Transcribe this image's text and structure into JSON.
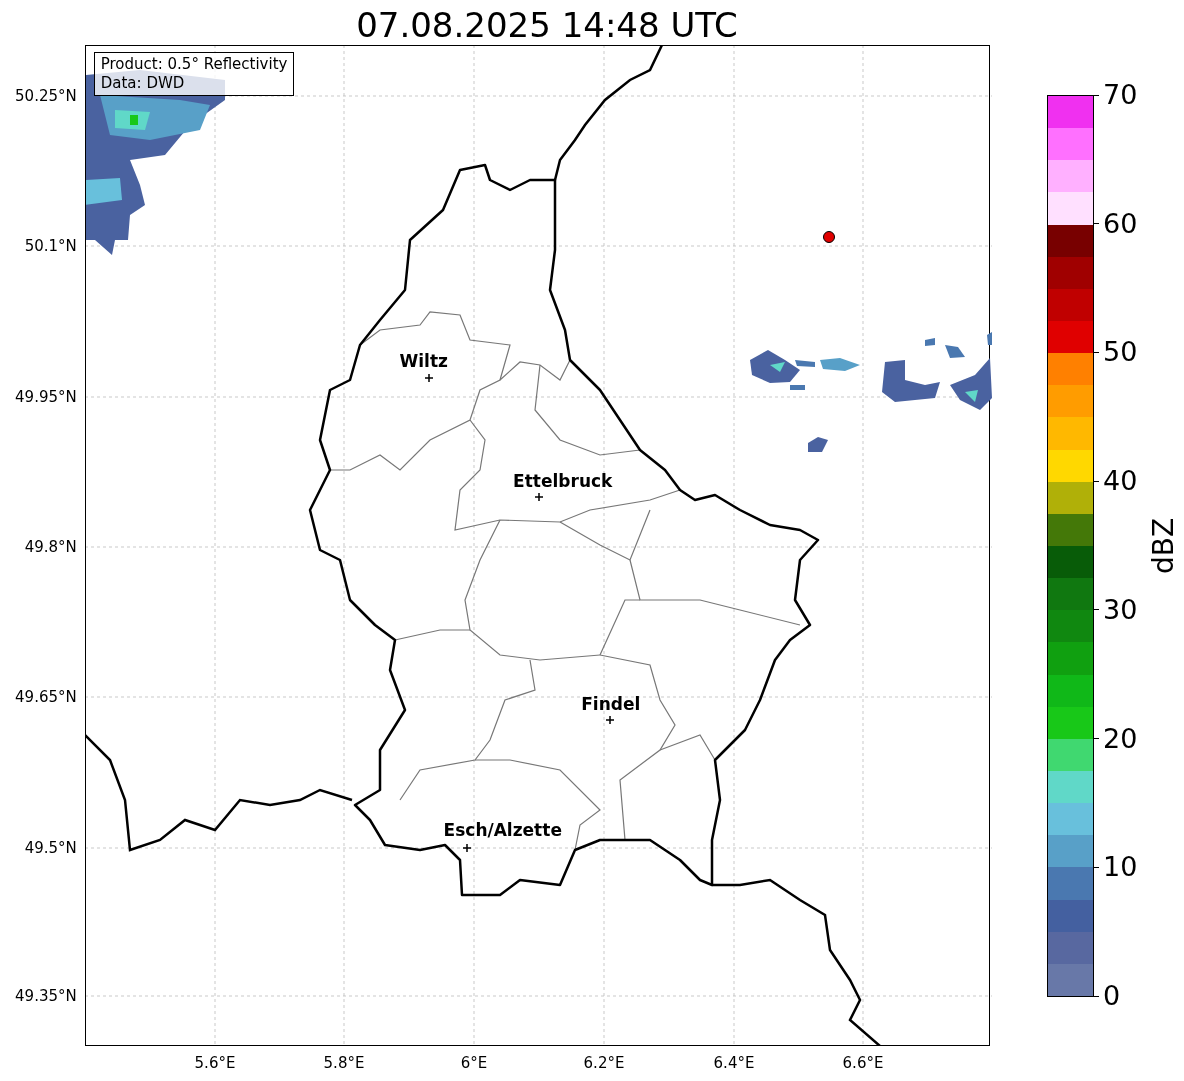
{
  "title": "07.08.2025 14:48 UTC",
  "info_box": {
    "lines": [
      "Product: 0.5° Reflectivity",
      "Data: DWD"
    ]
  },
  "y_ticks": [
    "50.25°N",
    "50.1°N",
    "49.95°N",
    "49.8°N",
    "49.65°N",
    "49.5°N",
    "49.35°N"
  ],
  "x_ticks": [
    "5.6°E",
    "5.8°E",
    "6°E",
    "6.2°E",
    "6.4°E",
    "6.6°E"
  ],
  "cities": [
    {
      "name": "Wiltz"
    },
    {
      "name": "Ettelbruck"
    },
    {
      "name": "Findel"
    },
    {
      "name": "Esch/Alzette"
    }
  ],
  "colorbar": {
    "label": "dBZ",
    "ticks": [
      "70",
      "60",
      "50",
      "40",
      "30",
      "20",
      "10",
      "0"
    ],
    "segments": [
      {
        "color": "#6878a8"
      },
      {
        "color": "#5868a0"
      },
      {
        "color": "#4460a0"
      },
      {
        "color": "#4a78b0"
      },
      {
        "color": "#58a0c8"
      },
      {
        "color": "#68c0dc"
      },
      {
        "color": "#60d8c8"
      },
      {
        "color": "#40d870"
      },
      {
        "color": "#18c818"
      },
      {
        "color": "#10b818"
      },
      {
        "color": "#10a010"
      },
      {
        "color": "#108810"
      },
      {
        "color": "#107810"
      },
      {
        "color": "#085c08"
      },
      {
        "color": "#447808"
      },
      {
        "color": "#b0b008"
      },
      {
        "color": "#ffd800"
      },
      {
        "color": "#ffb800"
      },
      {
        "color": "#ff9c00"
      },
      {
        "color": "#ff8000"
      },
      {
        "color": "#e00000"
      },
      {
        "color": "#c00000"
      },
      {
        "color": "#a00000"
      },
      {
        "color": "#780000"
      },
      {
        "color": "#ffe0ff"
      },
      {
        "color": "#ffb0ff"
      },
      {
        "color": "#ff70ff"
      },
      {
        "color": "#f030f0"
      }
    ]
  }
}
